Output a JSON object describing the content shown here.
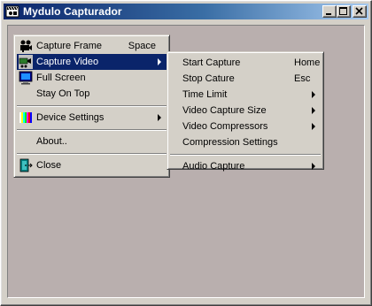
{
  "window": {
    "title": "Mydulo Capturador",
    "icon": "camera-clapper-icon",
    "client_color": "#b9afae",
    "titlebar_color": "#0a246a"
  },
  "main_menu": [
    {
      "label": "Capture Frame",
      "shortcut": "Space",
      "icon": "film-camera-icon"
    },
    {
      "label": "Capture Video",
      "shortcut": "",
      "icon": "video-camera-icon",
      "submenu": true,
      "selected": true
    },
    {
      "label": "Full Screen",
      "shortcut": "",
      "icon": "monitor-icon"
    },
    {
      "label": "Stay On Top",
      "shortcut": ""
    },
    {
      "label": "Device Settings",
      "shortcut": "",
      "icon": "color-bars-icon",
      "submenu": true
    },
    {
      "label": "About..",
      "shortcut": ""
    },
    {
      "label": "Close",
      "shortcut": "",
      "icon": "exit-door-icon"
    }
  ],
  "sub_menu": [
    {
      "label": "Start Capture",
      "shortcut": "Home"
    },
    {
      "label": "Stop Cature",
      "shortcut": "Esc"
    },
    {
      "label": "Time Limit",
      "submenu": true
    },
    {
      "label": "Video Capture Size",
      "submenu": true
    },
    {
      "label": "Video Compressors",
      "submenu": true
    },
    {
      "label": "Compression Settings"
    },
    {
      "label": "Audio Capture",
      "submenu": true
    }
  ]
}
